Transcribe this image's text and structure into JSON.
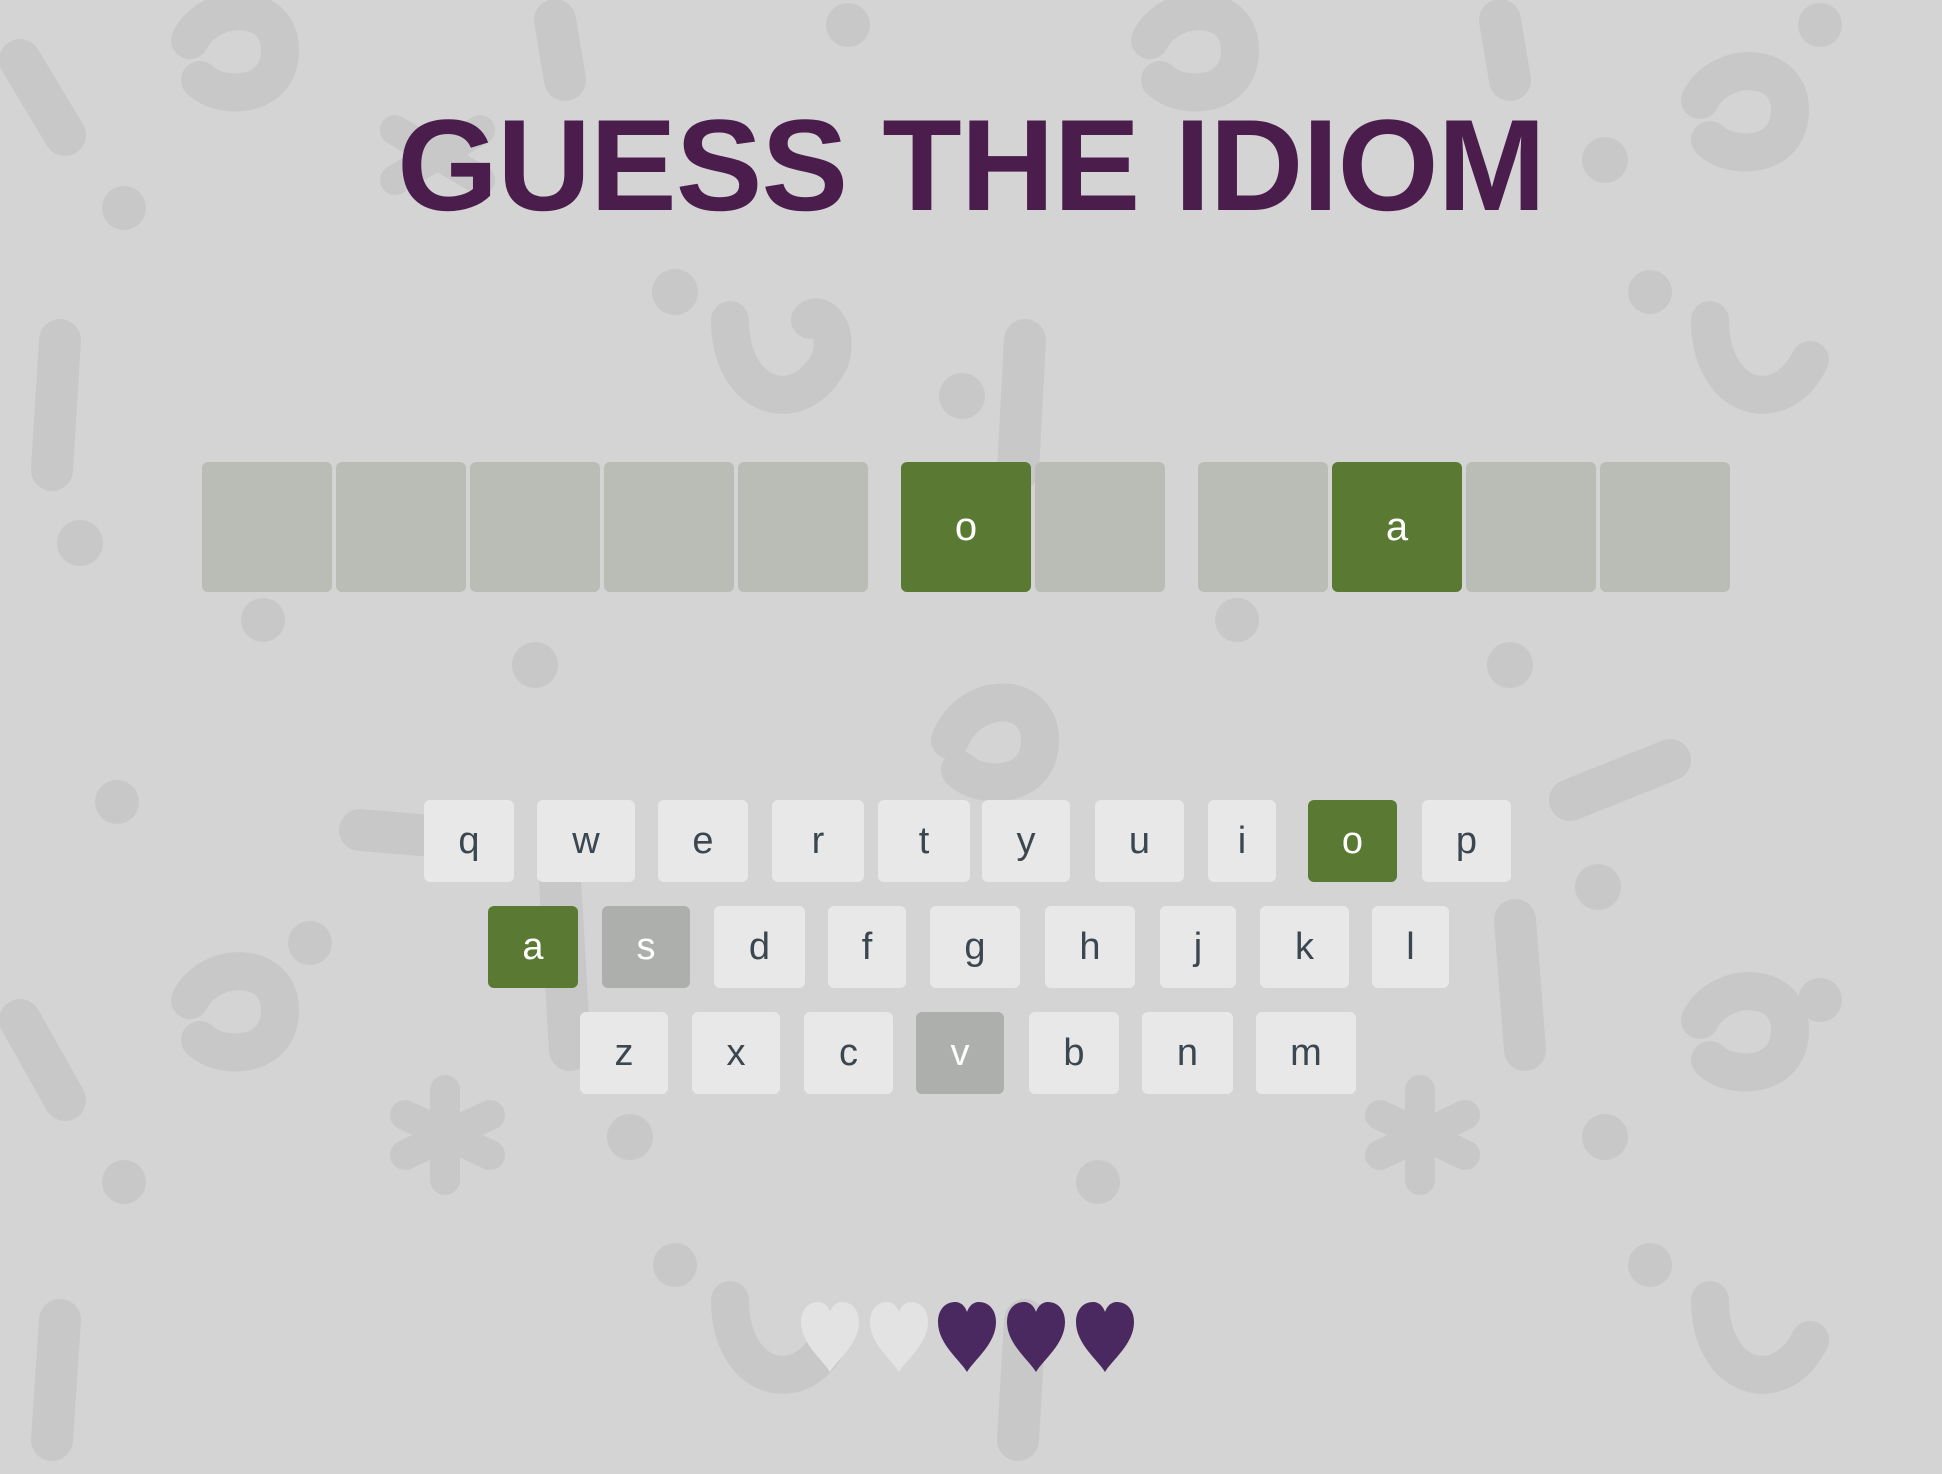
{
  "title": "GUESS THE IDIOM",
  "colors": {
    "background": "#d4d4d4",
    "title": "#4a1d4c",
    "tile_empty": "#babdb5",
    "tile_revealed": "#5a7a34",
    "key_default": "#e8e8e8",
    "key_correct": "#5a7a34",
    "key_absent": "#adafad",
    "heart_full": "#4a2860",
    "heart_empty": "#e3e3e3"
  },
  "board": {
    "words": [
      [
        "",
        "",
        "",
        "",
        ""
      ],
      [
        "o",
        ""
      ],
      [
        "",
        "a",
        "",
        ""
      ]
    ]
  },
  "keyboard": {
    "rows": [
      [
        {
          "label": "q",
          "state": "default"
        },
        {
          "label": "w",
          "state": "default"
        },
        {
          "label": "e",
          "state": "default"
        },
        {
          "label": "r",
          "state": "default"
        },
        {
          "label": "t",
          "state": "default"
        },
        {
          "label": "y",
          "state": "default"
        },
        {
          "label": "u",
          "state": "default"
        },
        {
          "label": "i",
          "state": "default"
        },
        {
          "label": "o",
          "state": "correct"
        },
        {
          "label": "p",
          "state": "default"
        }
      ],
      [
        {
          "label": "a",
          "state": "correct"
        },
        {
          "label": "s",
          "state": "absent"
        },
        {
          "label": "d",
          "state": "default"
        },
        {
          "label": "f",
          "state": "default"
        },
        {
          "label": "g",
          "state": "default"
        },
        {
          "label": "h",
          "state": "default"
        },
        {
          "label": "j",
          "state": "default"
        },
        {
          "label": "k",
          "state": "default"
        },
        {
          "label": "l",
          "state": "default"
        }
      ],
      [
        {
          "label": "z",
          "state": "default"
        },
        {
          "label": "x",
          "state": "default"
        },
        {
          "label": "c",
          "state": "default"
        },
        {
          "label": "v",
          "state": "absent"
        },
        {
          "label": "b",
          "state": "default"
        },
        {
          "label": "n",
          "state": "default"
        },
        {
          "label": "m",
          "state": "default"
        }
      ]
    ]
  },
  "lives": {
    "total": 5,
    "remaining": 3,
    "icon": "heart-icon"
  }
}
